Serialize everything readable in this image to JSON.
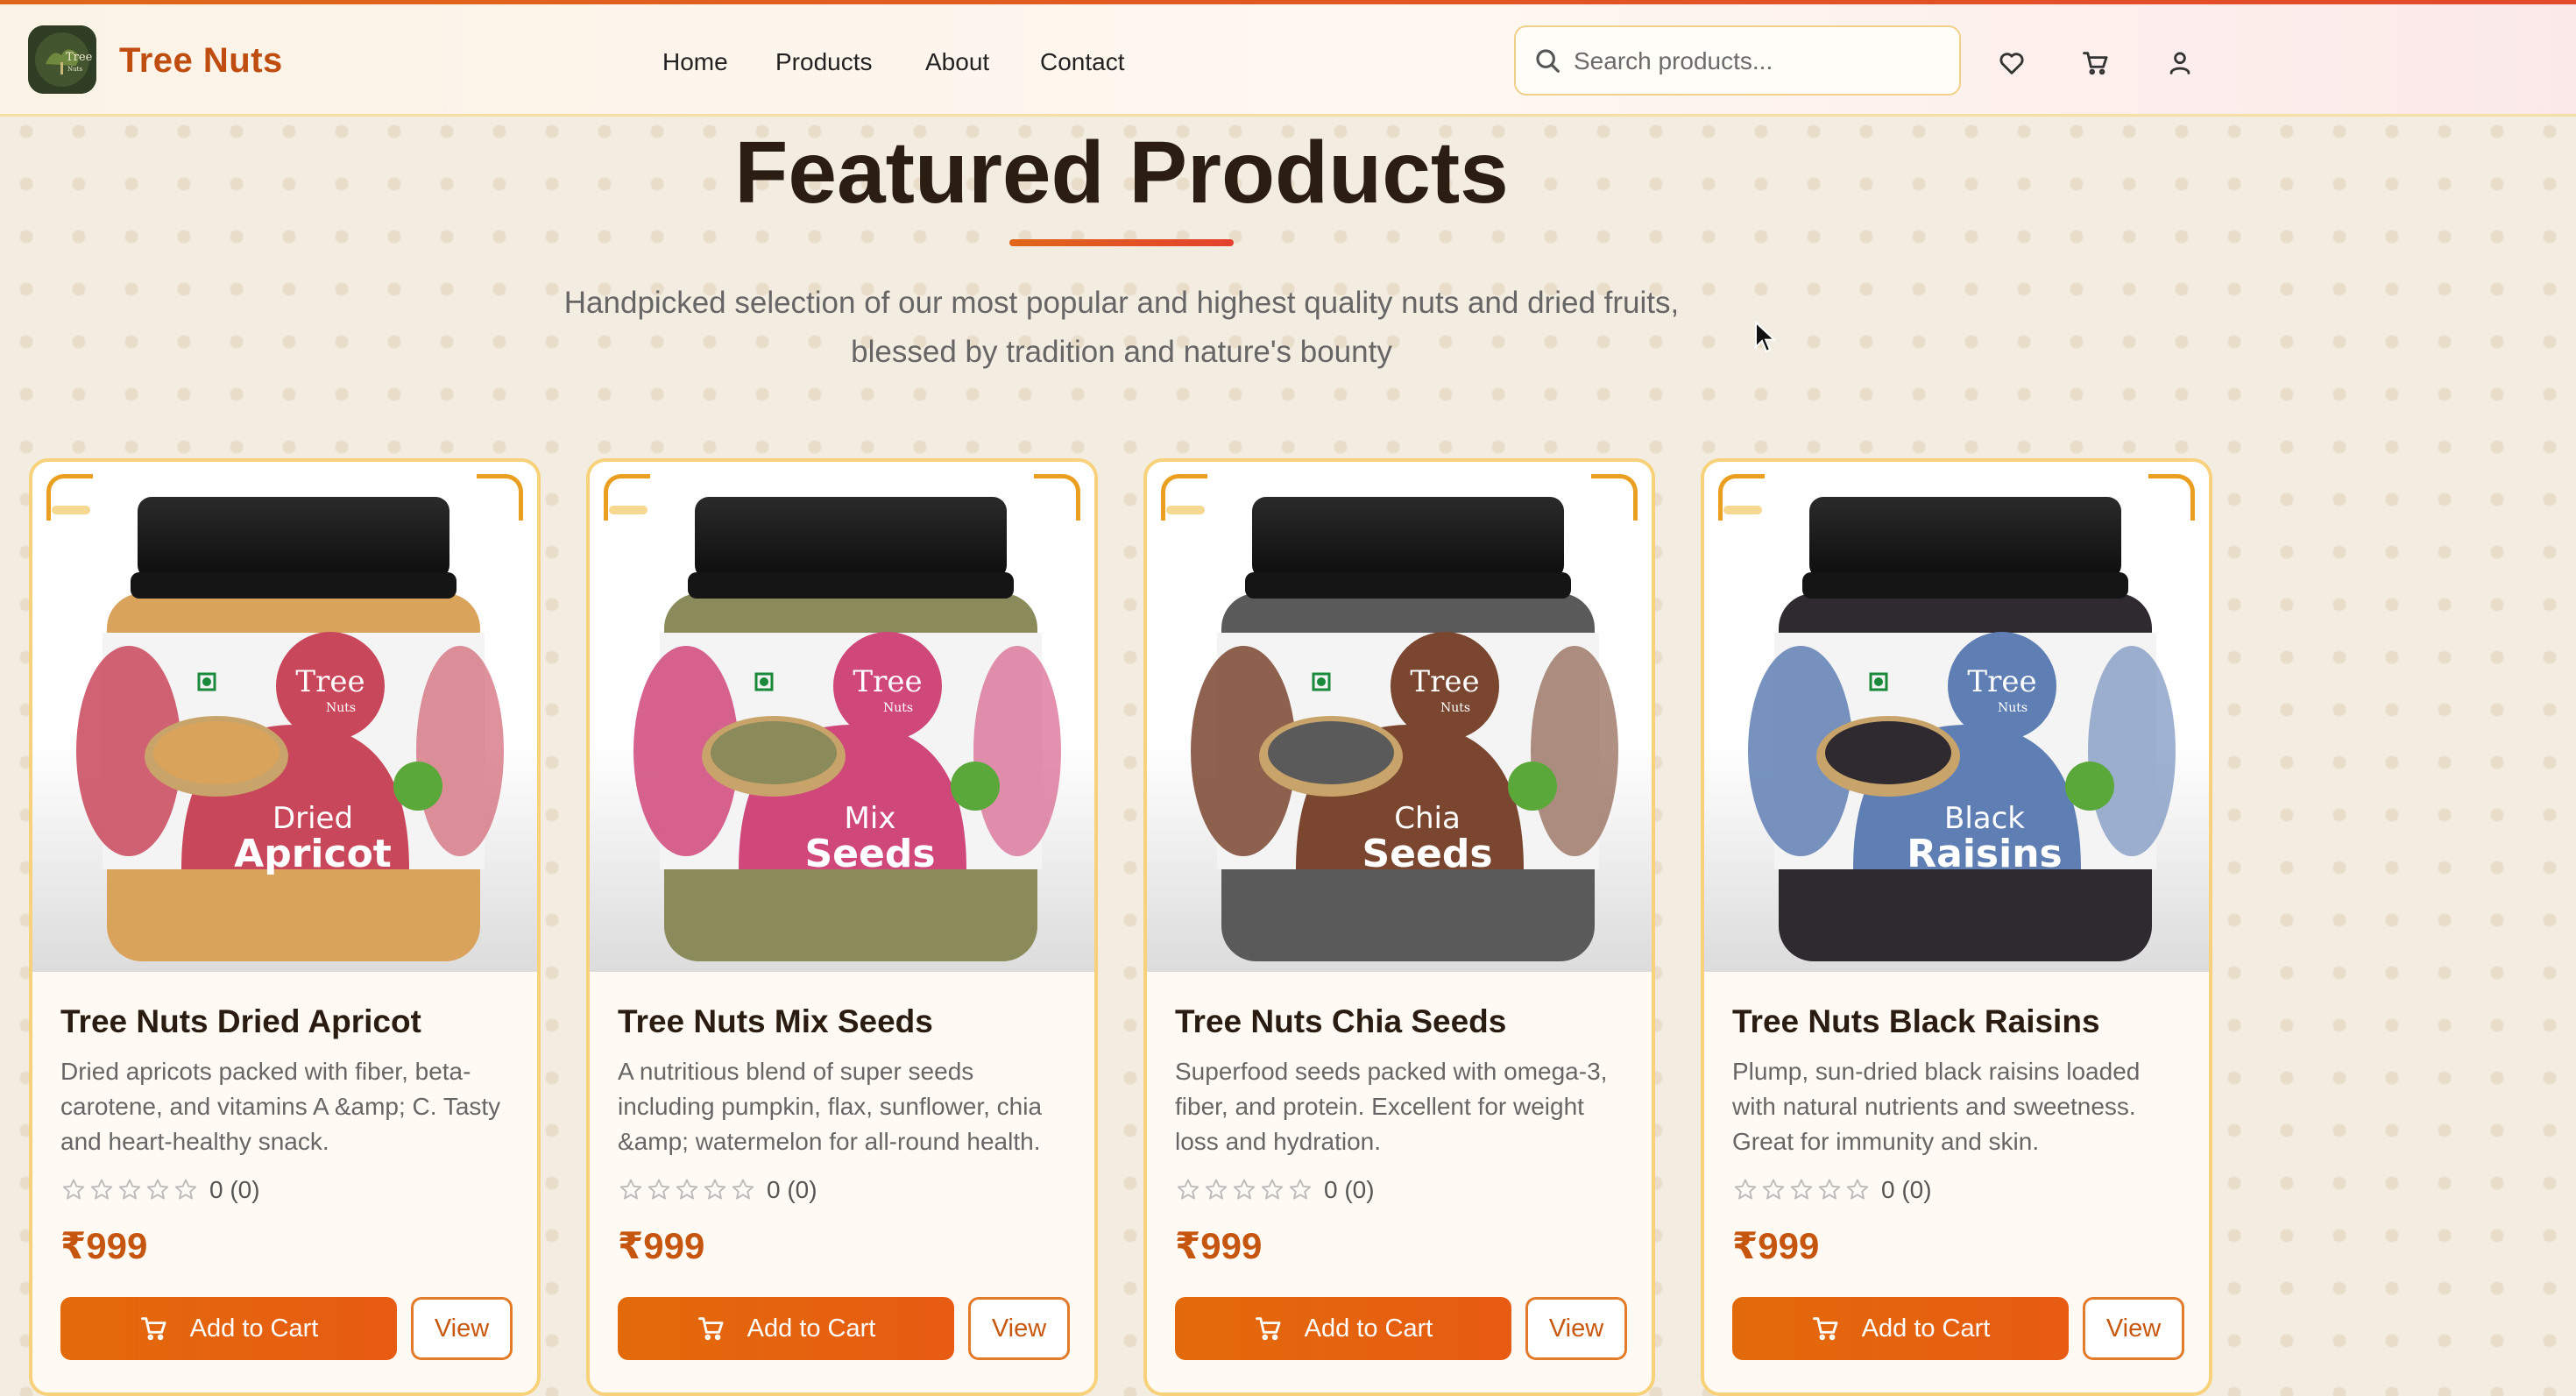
{
  "header": {
    "brand": "Tree Nuts",
    "logo_text": "Tree",
    "logo_subtext": "Nuts",
    "nav": [
      "Home",
      "Products",
      "About",
      "Contact"
    ],
    "search_placeholder": "Search products...",
    "icons": [
      "heart-icon",
      "cart-icon",
      "user-icon"
    ]
  },
  "section": {
    "title": "Featured Products",
    "subtitle_line1": "Handpicked selection of our most popular and highest quality nuts and dried fruits,",
    "subtitle_line2": "blessed by tradition and nature's bounty"
  },
  "colors": {
    "brand_orange": "#e36a0b",
    "card_border": "#f7d27a",
    "price": "#c6560f"
  },
  "products": [
    {
      "name": "Tree Nuts Dried Apricot",
      "desc": "Dried apricots packed with fiber, beta-carotene, and vitamins A &amp; C. Tasty and heart-healthy snack.",
      "label_top": "Dried",
      "label_bottom": "Apricot",
      "rating_text": "0 (0)",
      "rating": 0,
      "price": "₹999",
      "add_label": "Add to Cart",
      "view_label": "View",
      "label_color": "#c9475a",
      "fill_color": "#d9a35c"
    },
    {
      "name": "Tree Nuts Mix Seeds",
      "desc": "A nutritious blend of super seeds including pumpkin, flax, sunflower, chia &amp; watermelon for all-round health.",
      "label_top": "Mix",
      "label_bottom": "Seeds",
      "rating_text": "0 (0)",
      "rating": 0,
      "price": "₹999",
      "add_label": "Add to Cart",
      "view_label": "View",
      "label_color": "#d0477a",
      "fill_color": "#8a8a5a"
    },
    {
      "name": "Tree Nuts Chia Seeds",
      "desc": "Superfood seeds packed with omega-3, fiber, and protein. Excellent for weight loss and hydration.",
      "label_top": "Chia",
      "label_bottom": "Seeds",
      "rating_text": "0 (0)",
      "rating": 0,
      "price": "₹999",
      "add_label": "Add to Cart",
      "view_label": "View",
      "label_color": "#7a4630",
      "fill_color": "#5a5a5a"
    },
    {
      "name": "Tree Nuts Black Raisins",
      "desc": "Plump, sun-dried black raisins loaded with natural nutrients and sweetness. Great for immunity and skin.",
      "label_top": "Black",
      "label_bottom": "Raisins",
      "rating_text": "0 (0)",
      "rating": 0,
      "price": "₹999",
      "add_label": "Add to Cart",
      "view_label": "View",
      "label_color": "#5f7fb4",
      "fill_color": "#2e2a30"
    }
  ]
}
